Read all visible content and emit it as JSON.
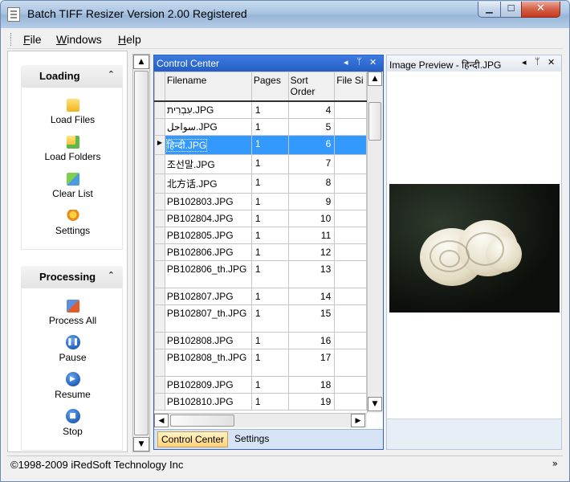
{
  "window": {
    "title": "Batch TIFF Resizer Version 2.00 Registered",
    "min_glyph": "▁",
    "max_glyph": "☐",
    "close_glyph": "✕"
  },
  "menu": {
    "file": {
      "ul": "F",
      "rest": "ile"
    },
    "windows": {
      "ul": "W",
      "rest": "indows"
    },
    "help": {
      "ul": "H",
      "rest": "elp"
    }
  },
  "sidebar": {
    "loading": {
      "title": "Loading",
      "collapse_glyph": "⌃",
      "items": [
        {
          "label": "Load Files",
          "icon": "folder-open-icon"
        },
        {
          "label": "Load Folders",
          "icon": "folder-add-icon"
        },
        {
          "label": "Clear List",
          "icon": "clear-list-icon"
        },
        {
          "label": "Settings",
          "icon": "settings-icon"
        }
      ]
    },
    "processing": {
      "title": "Processing",
      "collapse_glyph": "⌃",
      "items": [
        {
          "label": "Process All",
          "icon": "process-all-icon"
        },
        {
          "label": "Pause",
          "icon": "pause-icon",
          "glyph": "❚❚"
        },
        {
          "label": "Resume",
          "icon": "resume-icon",
          "glyph": "▶"
        },
        {
          "label": "Stop",
          "icon": "stop-icon",
          "glyph": "■"
        }
      ]
    }
  },
  "control_center": {
    "title": "Control Center",
    "controls": [
      "◂",
      "ᛘ",
      "✕"
    ],
    "columns": [
      "Filename",
      "Pages",
      "Sort Order",
      "File Si"
    ],
    "rows": [
      {
        "filename": "עִבְרִית.JPG",
        "pages": "1",
        "sort": "4"
      },
      {
        "filename": "سواحل.JPG",
        "pages": "1",
        "sort": "5"
      },
      {
        "filename": "हिन्दी.JPG",
        "pages": "1",
        "sort": "6",
        "selected": true
      },
      {
        "filename": "조선말.JPG",
        "pages": "1",
        "sort": "7"
      },
      {
        "filename": "北方话.JPG",
        "pages": "1",
        "sort": "8"
      },
      {
        "filename": "PB102803.JPG",
        "pages": "1",
        "sort": "9"
      },
      {
        "filename": "PB102804.JPG",
        "pages": "1",
        "sort": "10"
      },
      {
        "filename": "PB102805.JPG",
        "pages": "1",
        "sort": "11"
      },
      {
        "filename": "PB102806.JPG",
        "pages": "1",
        "sort": "12"
      },
      {
        "filename": "PB102806_th.JPG",
        "pages": "1",
        "sort": "13",
        "tall": true
      },
      {
        "filename": "PB102807.JPG",
        "pages": "1",
        "sort": "14"
      },
      {
        "filename": "PB102807_th.JPG",
        "pages": "1",
        "sort": "15",
        "tall": true
      },
      {
        "filename": "PB102808.JPG",
        "pages": "1",
        "sort": "16"
      },
      {
        "filename": "PB102808_th.JPG",
        "pages": "1",
        "sort": "17",
        "tall": true
      },
      {
        "filename": "PB102809.JPG",
        "pages": "1",
        "sort": "18"
      },
      {
        "filename": "PB102810.JPG",
        "pages": "1",
        "sort": "19"
      }
    ],
    "tabs": [
      "Control Center",
      "Settings"
    ]
  },
  "preview": {
    "title": "Image Preview - हिन्दी.JPG",
    "controls": [
      "◂",
      "ᛘ",
      "✕"
    ]
  },
  "status": {
    "text": "©1998-2009 iRedSoft Technology Inc",
    "grip": "»"
  }
}
